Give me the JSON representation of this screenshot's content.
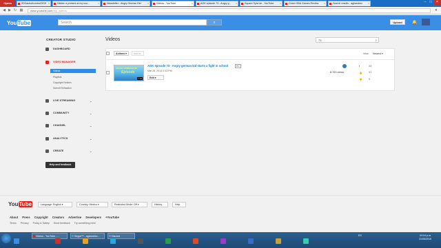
{
  "browser": {
    "menu_label": "Opera",
    "tabs": [
      {
        "label": "SDSautoelcontrol2019"
      },
      {
        "label": "Hidden a present at my sou..."
      },
      {
        "label": "Newsletter - Angry German Kid"
      },
      {
        "label": "Videos - YouTube"
      },
      {
        "label": "AGK episode 73 - Angry g..."
      },
      {
        "label": "Square Sylvi.de - YouTube"
      },
      {
        "label": "Crash GBA Games Review"
      },
      {
        "label": "Search results - agkandrez"
      }
    ],
    "url_host": "www.youtube.com",
    "url_path": "/my_videos"
  },
  "header": {
    "logo_text_a": "You",
    "logo_text_b": "Tube",
    "search_placeholder": "Search",
    "upload_label": "Upload"
  },
  "sidebar": {
    "title": "CREATOR STUDIO",
    "items": [
      {
        "label": "DASHBOARD"
      },
      {
        "label": "VIDEO MANAGER"
      },
      {
        "label": "LIVE STREAMING"
      },
      {
        "label": "COMMUNITY"
      },
      {
        "label": "CHANNEL"
      },
      {
        "label": "ANALYTICS"
      },
      {
        "label": "CREATE"
      }
    ],
    "sub_items": [
      {
        "label": "Videos"
      },
      {
        "label": "Playlists"
      },
      {
        "label": "Copyright Notices"
      },
      {
        "label": "Submit Refraction"
      }
    ],
    "help_label": "Help and feedback"
  },
  "main": {
    "title": "Videos",
    "filter_value": "73",
    "actions_label": "Actions ▾",
    "addto_label": "Add to",
    "view_label": "View",
    "sort_label": "Newest ▾",
    "video": {
      "thumb_title": "ANGRY GERMAN KID",
      "thumb_episode": "Episode",
      "duration": "7:31",
      "title": "AGK episode 73 - Angry german kid starts a fight in school",
      "hd": "HD",
      "date": "Mar 28, 2013 2:03 PM",
      "edit_label": "Edit ▾",
      "views": "8,763 views",
      "comments": "33",
      "likes": "91",
      "dislikes": "5"
    }
  },
  "footer": {
    "logo_a": "You",
    "logo_b": "Tube",
    "language": "Language: English ▾",
    "country": "Country: Mexico ▾",
    "restricted": "Restricted Mode: Off ▾",
    "history": "History",
    "help": "Help",
    "links": [
      "About",
      "Press",
      "Copyright",
      "Creators",
      "Advertise",
      "Developers",
      "+YouTube"
    ],
    "links2": [
      "Terms",
      "Privacy",
      "Policy & Safety",
      "Send feedback",
      "Try something new!"
    ]
  },
  "taskbar": {
    "tasks": [
      {
        "label": "Videos - YouTube - ..."
      },
      {
        "label": "Skype™ - agkandrez..."
      },
      {
        "label": "Discord"
      }
    ],
    "tray_text": "ES",
    "time": "03:04 p.m.",
    "date": "31/05/2016"
  }
}
